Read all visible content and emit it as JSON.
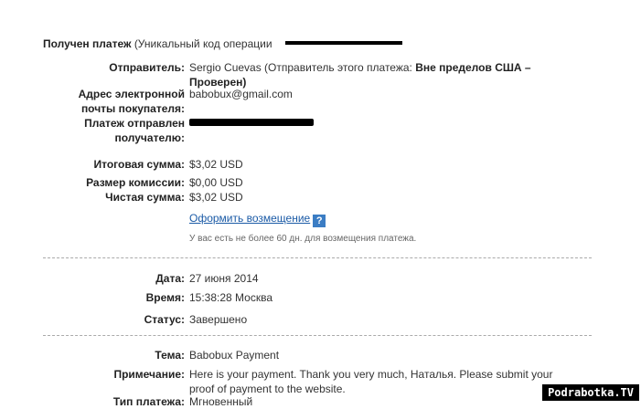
{
  "header": {
    "title": "Получен платеж",
    "subtitle": "(Уникальный код операции"
  },
  "sender": {
    "label": "Отправитель:",
    "name": "Sergio Cuevas (Отправитель этого платежа: ",
    "status": "Вне пределов США – Проверен)"
  },
  "buyer_email": {
    "label": "Адрес электронной почты покупателя:",
    "value": "babobux@gmail.com"
  },
  "sent_to": {
    "label": "Платеж отправлен получателю:"
  },
  "amounts": {
    "total_label": "Итоговая сумма:",
    "total_value": "$3,02 USD",
    "fee_label": "Размер комиссии:",
    "fee_value": "$0,00 USD",
    "net_label": "Чистая сумма:",
    "net_value": "$3,02 USD"
  },
  "refund": {
    "link": "Оформить возмещение",
    "help": "?",
    "note": "У вас есть не более 60 дн. для возмещения платежа."
  },
  "details": {
    "date_label": "Дата:",
    "date_value": "27 июня 2014",
    "time_label": "Время:",
    "time_value": "15:38:28 Москва",
    "status_label": "Статус:",
    "status_value": "Завершено"
  },
  "message": {
    "subject_label": "Тема:",
    "subject_value": "Babobux Payment",
    "note_label": "Примечание:",
    "note_value": "Here is your payment. Thank you very much, Наталья. Please submit your proof of payment to the website.",
    "type_label": "Тип платежа:",
    "type_value": "Мгновенный"
  },
  "watermark": "Podrabotka.TV"
}
